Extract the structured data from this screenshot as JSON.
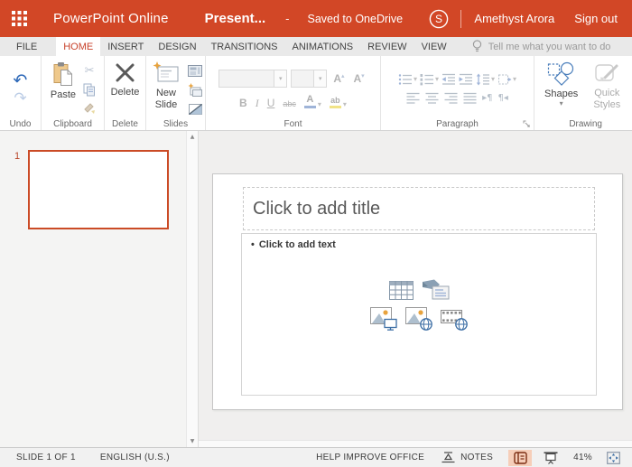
{
  "icons": {
    "dropdown_arrow": "▾",
    "undo_arrow": "↶",
    "redo_arrow": "↷",
    "scissors": "✂",
    "scroll_up": "▲",
    "scroll_down": "▼",
    "grow_font_arrow": "▴",
    "shrink_font_arrow": "▾",
    "ltr_mark": "▸¶",
    "rtl_mark": "¶◂"
  },
  "topbar": {
    "app_name": "PowerPoint Online",
    "doc_title": "Present...",
    "separator": "-",
    "save_status": "Saved to OneDrive",
    "skype_initial": "S",
    "user_name": "Amethyst Arora",
    "sign_out_label": "Sign out"
  },
  "tabbar": {
    "tabs": [
      "FILE",
      "HOME",
      "INSERT",
      "DESIGN",
      "TRANSITIONS",
      "ANIMATIONS",
      "REVIEW",
      "VIEW"
    ],
    "active_tab": "HOME",
    "tell_me": "Tell me what you want to do"
  },
  "ribbon": {
    "undo_group_label": "Undo",
    "clipboard_group_label": "Clipboard",
    "paste_label": "Paste",
    "delete_group_label": "Delete",
    "delete_label": "Delete",
    "slides_group_label": "Slides",
    "new_slide_label": "New Slide",
    "font_group_label": "Font",
    "bold_label": "B",
    "italic_label": "I",
    "underline_label": "U",
    "strikethrough_label": "abc",
    "font_color_label": "A",
    "highlight_label": "ab",
    "paragraph_group_label": "Paragraph",
    "drawing_group_label": "Drawing",
    "shapes_label": "Shapes",
    "quick_styles_label": "Quick Styles"
  },
  "slide_panel": {
    "slide_number": "1"
  },
  "canvas": {
    "title_placeholder": "Click to add title",
    "bullet": "•",
    "body_placeholder": "Click to add text"
  },
  "statusbar": {
    "slide_count": "SLIDE 1 OF 1",
    "language": "ENGLISH (U.S.)",
    "help_improve": "HELP IMPROVE OFFICE",
    "notes_label": "NOTES",
    "zoom_level": "41%"
  },
  "colors": {
    "brand": "#D24726",
    "active_tab_text": "#C8432C",
    "selected_slide_border": "#CB4B26",
    "status_active_bg": "#F6CEB9"
  }
}
